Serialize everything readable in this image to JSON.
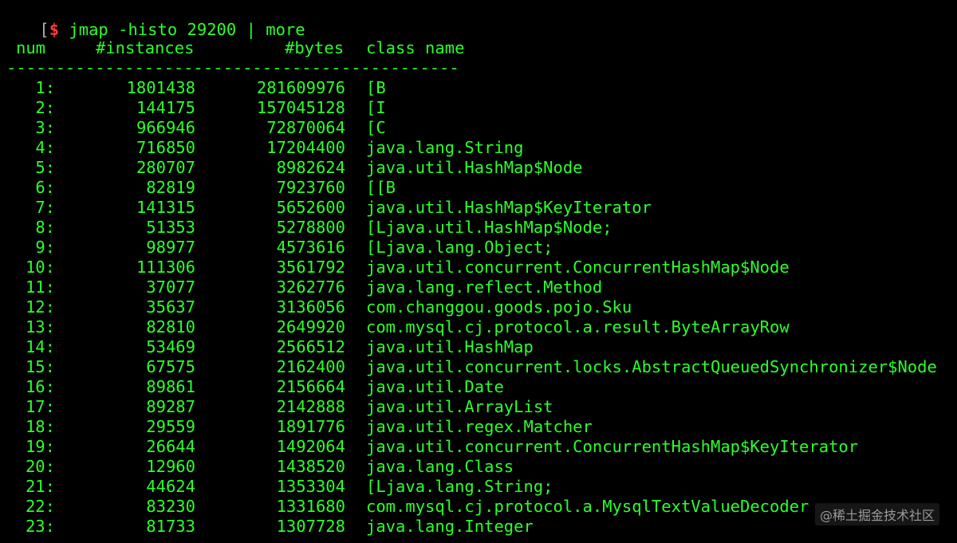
{
  "command": {
    "prompt_bracket": "[",
    "prompt_symbol": "$",
    "text": "jmap -histo 29200 | more"
  },
  "headers": {
    "num": "num",
    "instances": "#instances",
    "bytes": "#bytes",
    "class_name": "class name"
  },
  "separator": "----------------------------------------------",
  "rows": [
    {
      "num": "1:",
      "instances": "1801438",
      "bytes": "281609976",
      "class": "[B"
    },
    {
      "num": "2:",
      "instances": "144175",
      "bytes": "157045128",
      "class": "[I"
    },
    {
      "num": "3:",
      "instances": "966946",
      "bytes": "72870064",
      "class": "[C"
    },
    {
      "num": "4:",
      "instances": "716850",
      "bytes": "17204400",
      "class": "java.lang.String"
    },
    {
      "num": "5:",
      "instances": "280707",
      "bytes": "8982624",
      "class": "java.util.HashMap$Node"
    },
    {
      "num": "6:",
      "instances": "82819",
      "bytes": "7923760",
      "class": "[[B"
    },
    {
      "num": "7:",
      "instances": "141315",
      "bytes": "5652600",
      "class": "java.util.HashMap$KeyIterator"
    },
    {
      "num": "8:",
      "instances": "51353",
      "bytes": "5278800",
      "class": "[Ljava.util.HashMap$Node;"
    },
    {
      "num": "9:",
      "instances": "98977",
      "bytes": "4573616",
      "class": "[Ljava.lang.Object;"
    },
    {
      "num": "10:",
      "instances": "111306",
      "bytes": "3561792",
      "class": "java.util.concurrent.ConcurrentHashMap$Node"
    },
    {
      "num": "11:",
      "instances": "37077",
      "bytes": "3262776",
      "class": "java.lang.reflect.Method"
    },
    {
      "num": "12:",
      "instances": "35637",
      "bytes": "3136056",
      "class": "com.changgou.goods.pojo.Sku"
    },
    {
      "num": "13:",
      "instances": "82810",
      "bytes": "2649920",
      "class": "com.mysql.cj.protocol.a.result.ByteArrayRow"
    },
    {
      "num": "14:",
      "instances": "53469",
      "bytes": "2566512",
      "class": "java.util.HashMap"
    },
    {
      "num": "15:",
      "instances": "67575",
      "bytes": "2162400",
      "class": "java.util.concurrent.locks.AbstractQueuedSynchronizer$Node"
    },
    {
      "num": "16:",
      "instances": "89861",
      "bytes": "2156664",
      "class": "java.util.Date"
    },
    {
      "num": "17:",
      "instances": "89287",
      "bytes": "2142888",
      "class": "java.util.ArrayList"
    },
    {
      "num": "18:",
      "instances": "29559",
      "bytes": "1891776",
      "class": "java.util.regex.Matcher"
    },
    {
      "num": "19:",
      "instances": "26644",
      "bytes": "1492064",
      "class": "java.util.concurrent.ConcurrentHashMap$KeyIterator"
    },
    {
      "num": "20:",
      "instances": "12960",
      "bytes": "1438520",
      "class": "java.lang.Class"
    },
    {
      "num": "21:",
      "instances": "44624",
      "bytes": "1353304",
      "class": "[Ljava.lang.String;"
    },
    {
      "num": "22:",
      "instances": "83230",
      "bytes": "1331680",
      "class": "com.mysql.cj.protocol.a.MysqlTextValueDecoder"
    },
    {
      "num": "23:",
      "instances": "81733",
      "bytes": "1307728",
      "class": "java.lang.Integer"
    }
  ],
  "watermark": "@稀土掘金技术社区",
  "colors": {
    "background": "#000000",
    "text": "#2bff2b",
    "prompt_symbol": "#ff3b3b"
  }
}
